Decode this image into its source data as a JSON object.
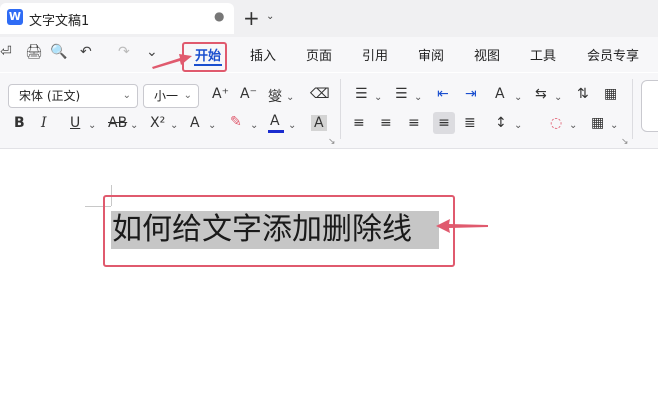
{
  "title_bar": {
    "app_icon_letter": "W",
    "doc_title": "文字文稿1",
    "unsaved_dot": "●",
    "new_tab": "+",
    "tab_menu": "⌄"
  },
  "menu": {
    "quick": [
      "⏎",
      "🖨",
      "🔍",
      "↶",
      "↷",
      "⌄"
    ],
    "items": [
      "开始",
      "插入",
      "页面",
      "引用",
      "审阅",
      "视图",
      "工具",
      "会员专享"
    ]
  },
  "ribbon": {
    "font_name": "宋体 (正文)",
    "font_size": "小一",
    "row1_buttons": [
      "A⁺",
      "A⁻",
      "燮",
      "⌫"
    ],
    "row2_buttons": [
      "B",
      "I",
      "U",
      "AB",
      "X²",
      "A",
      "✎",
      "A",
      "A"
    ],
    "para_row1": [
      "☰",
      "☰",
      "⇤",
      "⇥",
      "A",
      "⇆",
      "⇅",
      "▦"
    ],
    "para_row2": [
      "≡",
      "≡",
      "≡",
      "≡",
      "≣",
      "↕",
      "◌",
      "▦"
    ]
  },
  "document": {
    "text": "如何给文字添加删除线"
  },
  "colors": {
    "accent": "#1a4fcf",
    "annotation": "#e05a6e",
    "highlight": "#c6c6c6"
  }
}
